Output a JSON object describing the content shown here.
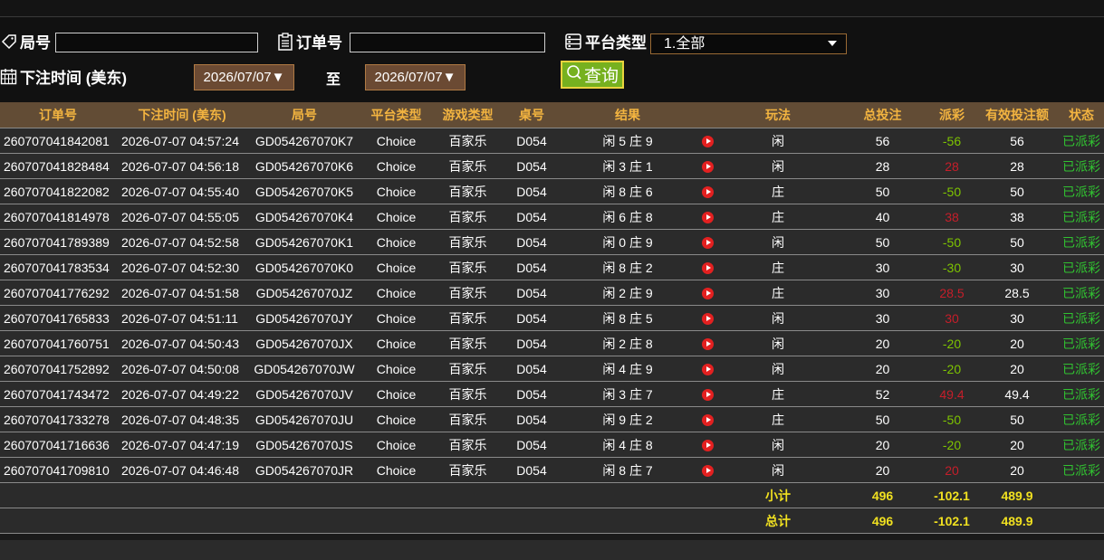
{
  "filters": {
    "round_label": "局号",
    "round_value": "",
    "order_label": "订单号",
    "order_value": "",
    "platform_label": "平台类型",
    "platform_selected": "1.全部",
    "time_label": "下注时间 (美东)",
    "date_from": "2026/07/07▼",
    "to_label": "至",
    "date_to": "2026/07/07▼",
    "query_label": "查询"
  },
  "table": {
    "headers": [
      "订单号",
      "下注时间 (美东)",
      "局号",
      "平台类型",
      "游戏类型",
      "桌号",
      "结果",
      "",
      "玩法",
      "总投注",
      "派彩",
      "有效投注额",
      "状态"
    ],
    "rows": [
      [
        "260707041842081",
        "2026-07-07 04:57:24",
        "GD054267070K7",
        "Choice",
        "百家乐",
        "D054",
        "闲 5 庄 9",
        "",
        "闲",
        "56",
        "-56",
        "56",
        "已派彩"
      ],
      [
        "260707041828484",
        "2026-07-07 04:56:18",
        "GD054267070K6",
        "Choice",
        "百家乐",
        "D054",
        "闲 3 庄 1",
        "",
        "闲",
        "28",
        "28",
        "28",
        "已派彩"
      ],
      [
        "260707041822082",
        "2026-07-07 04:55:40",
        "GD054267070K5",
        "Choice",
        "百家乐",
        "D054",
        "闲 8 庄 6",
        "",
        "庄",
        "50",
        "-50",
        "50",
        "已派彩"
      ],
      [
        "260707041814978",
        "2026-07-07 04:55:05",
        "GD054267070K4",
        "Choice",
        "百家乐",
        "D054",
        "闲 6 庄 8",
        "",
        "庄",
        "40",
        "38",
        "38",
        "已派彩"
      ],
      [
        "260707041789389",
        "2026-07-07 04:52:58",
        "GD054267070K1",
        "Choice",
        "百家乐",
        "D054",
        "闲 0 庄 9",
        "",
        "闲",
        "50",
        "-50",
        "50",
        "已派彩"
      ],
      [
        "260707041783534",
        "2026-07-07 04:52:30",
        "GD054267070K0",
        "Choice",
        "百家乐",
        "D054",
        "闲 8 庄 2",
        "",
        "庄",
        "30",
        "-30",
        "30",
        "已派彩"
      ],
      [
        "260707041776292",
        "2026-07-07 04:51:58",
        "GD054267070JZ",
        "Choice",
        "百家乐",
        "D054",
        "闲 2 庄 9",
        "",
        "庄",
        "30",
        "28.5",
        "28.5",
        "已派彩"
      ],
      [
        "260707041765833",
        "2026-07-07 04:51:11",
        "GD054267070JY",
        "Choice",
        "百家乐",
        "D054",
        "闲 8 庄 5",
        "",
        "闲",
        "30",
        "30",
        "30",
        "已派彩"
      ],
      [
        "260707041760751",
        "2026-07-07 04:50:43",
        "GD054267070JX",
        "Choice",
        "百家乐",
        "D054",
        "闲 2 庄 8",
        "",
        "闲",
        "20",
        "-20",
        "20",
        "已派彩"
      ],
      [
        "260707041752892",
        "2026-07-07 04:50:08",
        "GD054267070JW",
        "Choice",
        "百家乐",
        "D054",
        "闲 4 庄 9",
        "",
        "闲",
        "20",
        "-20",
        "20",
        "已派彩"
      ],
      [
        "260707041743472",
        "2026-07-07 04:49:22",
        "GD054267070JV",
        "Choice",
        "百家乐",
        "D054",
        "闲 3 庄 7",
        "",
        "庄",
        "52",
        "49.4",
        "49.4",
        "已派彩"
      ],
      [
        "260707041733278",
        "2026-07-07 04:48:35",
        "GD054267070JU",
        "Choice",
        "百家乐",
        "D054",
        "闲 9 庄 2",
        "",
        "庄",
        "50",
        "-50",
        "50",
        "已派彩"
      ],
      [
        "260707041716636",
        "2026-07-07 04:47:19",
        "GD054267070JS",
        "Choice",
        "百家乐",
        "D054",
        "闲 4 庄 8",
        "",
        "闲",
        "20",
        "-20",
        "20",
        "已派彩"
      ],
      [
        "260707041709810",
        "2026-07-07 04:46:48",
        "GD054267070JR",
        "Choice",
        "百家乐",
        "D054",
        "闲 8 庄 7",
        "",
        "闲",
        "20",
        "20",
        "20",
        "已派彩"
      ]
    ],
    "subtotal": {
      "label": "小计",
      "total_bet": "496",
      "payout": "-102.1",
      "valid_bet": "489.9"
    },
    "total": {
      "label": "总计",
      "total_bet": "496",
      "payout": "-102.1",
      "valid_bet": "489.9"
    }
  },
  "icons": {
    "round": "tag-icon",
    "order": "clipboard-icon",
    "platform": "server-list-icon",
    "time": "calendar-icon",
    "query": "search-icon",
    "replay": "play-icon"
  },
  "colors": {
    "header_bg": "#624c35",
    "header_text": "#f3b440",
    "negative_payout": "#7ec400",
    "positive_payout": "#c61e2a",
    "status": "#31c231",
    "summary_text": "#f0e020",
    "query_button": "#76b11f"
  }
}
